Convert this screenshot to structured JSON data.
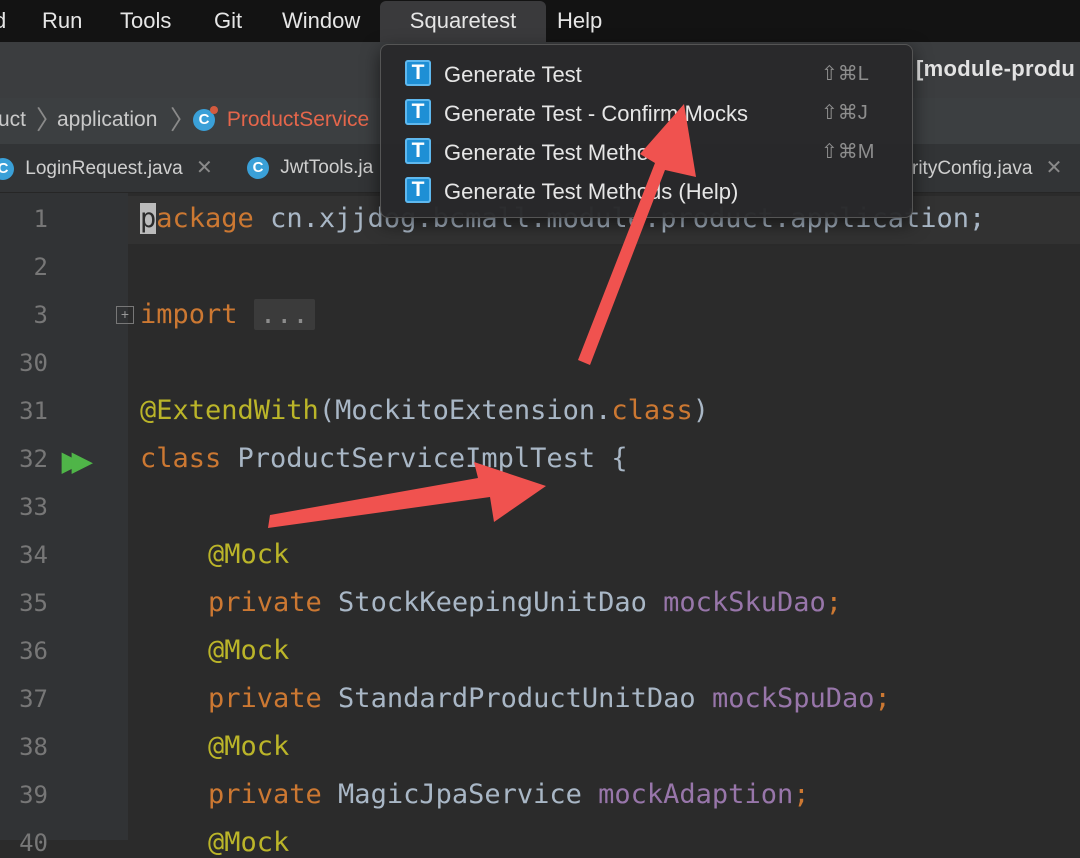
{
  "menubar": {
    "items": [
      "d",
      "Run",
      "Tools",
      "Git",
      "Window",
      "Squaretest",
      "Help"
    ],
    "active": "Squaretest"
  },
  "window": {
    "title_fragment": "[module-produ"
  },
  "breadcrumb": {
    "items": [
      "uct",
      "application",
      "ProductService"
    ]
  },
  "tabs": [
    {
      "label": "LoginRequest.java"
    },
    {
      "label": "JwtTools.ja"
    },
    {
      "label": "rityConfig.java"
    }
  ],
  "editor": {
    "lines": [
      {
        "num": "1"
      },
      {
        "num": "2"
      },
      {
        "num": "3"
      },
      {
        "num": "30"
      },
      {
        "num": "31"
      },
      {
        "num": "32"
      },
      {
        "num": "33"
      },
      {
        "num": "34"
      },
      {
        "num": "35"
      },
      {
        "num": "36"
      },
      {
        "num": "37"
      },
      {
        "num": "38"
      },
      {
        "num": "39"
      },
      {
        "num": "40"
      }
    ],
    "package_caret": "p",
    "package_kw_rest": "ackage",
    "package_name": " cn.xjjdog.bcmall.module.product.application;",
    "import_kw": "import",
    "import_fold": "...",
    "annotation_extend": "@ExtendWith",
    "extend_arg": "(MockitoExtension.",
    "class_kw_inline": "class",
    "extend_close": ")",
    "class_kw": "class",
    "class_name": " ProductServiceImplTest {",
    "mock1": "@Mock",
    "private1": "private",
    "type1": " StockKeepingUnitDao ",
    "field1": "mockSkuDao",
    "mock2": "@Mock",
    "private2": "private",
    "type2": " StandardProductUnitDao ",
    "field2": "mockSpuDao",
    "mock3": "@Mock",
    "private3": "private",
    "type3": " MagicJpaService ",
    "field3": "mockAdaption",
    "semicolon": ";",
    "mock4": "@Mock"
  },
  "dropdown": {
    "items": [
      {
        "label": "Generate Test",
        "shortcut": "⇧⌘L"
      },
      {
        "label": "Generate Test - Confirm Mocks",
        "shortcut": "⇧⌘J"
      },
      {
        "label": "Generate Test Methods",
        "shortcut": "⇧⌘M"
      },
      {
        "label": "Generate Test Methods (Help)",
        "shortcut": ""
      }
    ]
  },
  "icons": {
    "squaretest_item": "T",
    "class_file": "C",
    "run_gutter": "run-double-arrow-icon"
  },
  "colors": {
    "accent_arrow": "#f0524f",
    "keyword": "#cc7832",
    "annotation": "#bbb529",
    "field": "#9876aa",
    "squaretest_icon": "#1e8fd5"
  }
}
